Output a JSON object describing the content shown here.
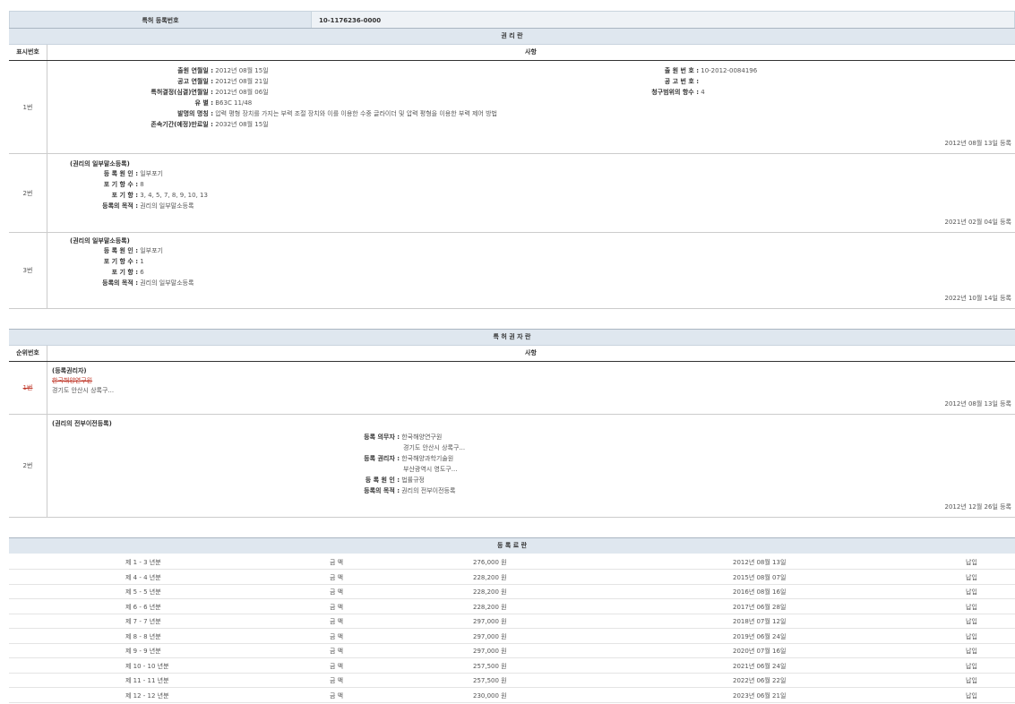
{
  "registration": {
    "label": "특허 등록번호",
    "value": "10-1176236-0000"
  },
  "rights": {
    "title": "권 리 란",
    "col_num": "표시번호",
    "col_detail": "사항",
    "entry1": {
      "num": "1번",
      "left": [
        {
          "k": "출원 연월일 :",
          "v": "2012년 08월 15일"
        },
        {
          "k": "공고 연월일 :",
          "v": "2012년 08월 21일"
        },
        {
          "k": "특허결정(심결)연월일 :",
          "v": "2012년 08월 06일"
        },
        {
          "k": "유 별 :",
          "v": "B63C 11/48"
        },
        {
          "k": "발명의 명칭 :",
          "v": "압력 평형 장치를 가지는 부력 조절 장치와 이를 이용한 수중 글라이더 및 압력 평형을 이용한 부력 제어 방법"
        },
        {
          "k": "존속기간(예정)만료일 :",
          "v": "2032년 08월 15일"
        }
      ],
      "right": [
        {
          "k": "출 원 번 호 :",
          "v": "10-2012-0084196"
        },
        {
          "k": "공 고 번 호 :",
          "v": ""
        },
        {
          "k": "청구범위의 항수 :",
          "v": "4"
        }
      ],
      "date": "2012년 08월 13일 등록"
    },
    "entry2": {
      "num": "2번",
      "head": "(권리의 일부말소등록)",
      "items": [
        {
          "k": "등 록 원 인 :",
          "v": "일부포기"
        },
        {
          "k": "포 기 항 수 :",
          "v": "8"
        },
        {
          "k": "포 기 항 :",
          "v": "3, 4, 5, 7, 8, 9, 10, 13"
        },
        {
          "k": "등록의 목적 :",
          "v": "권리의 일부말소등록"
        }
      ],
      "date": "2021년 02월 04일 등록"
    },
    "entry3": {
      "num": "3번",
      "head": "(권리의 일부말소등록)",
      "items": [
        {
          "k": "등 록 원 인 :",
          "v": "일부포기"
        },
        {
          "k": "포 기 항 수 :",
          "v": "1"
        },
        {
          "k": "포 기 항 :",
          "v": "6"
        },
        {
          "k": "등록의 목적 :",
          "v": "권리의 일부말소등록"
        }
      ],
      "date": "2022년 10월 14일 등록"
    }
  },
  "holders": {
    "title": "특 허 권 자 란",
    "col_num": "순위번호",
    "col_detail": "사항",
    "entry1": {
      "num": "1번",
      "head": "(등록권리자)",
      "name": "한국해양연구원",
      "addr": "경기도 안산시 상록구...",
      "date": "2012년 08월 13일 등록"
    },
    "entry2": {
      "num": "2번",
      "head": "(권리의 전부이전등록)",
      "obligor_k": "등록 의무자 :",
      "obligor_v": "한국해양연구원",
      "obligor_addr": "경기도 안산시 상록구...",
      "holder_k": "등록 권리자 :",
      "holder_v": "한국해양과학기술원",
      "holder_addr": "부산광역시 영도구...",
      "cause_k": "등 록 원 인 :",
      "cause_v": "법률규정",
      "purpose_k": "등록의 목적 :",
      "purpose_v": "권리의 전부이전등록",
      "date": "2012년 12월 26일 등록"
    }
  },
  "fees": {
    "title": "등 록 료 란",
    "rows": [
      {
        "period": "제 1 - 3 년분",
        "label": "금 액",
        "amount": "276,000 원",
        "date": "2012년 08월 13일",
        "status": "납입"
      },
      {
        "period": "제 4 - 4 년분",
        "label": "금 액",
        "amount": "228,200 원",
        "date": "2015년 08월 07일",
        "status": "납입"
      },
      {
        "period": "제 5 - 5 년분",
        "label": "금 액",
        "amount": "228,200 원",
        "date": "2016년 08월 16일",
        "status": "납입"
      },
      {
        "period": "제 6 - 6 년분",
        "label": "금 액",
        "amount": "228,200 원",
        "date": "2017년 06월 28일",
        "status": "납입"
      },
      {
        "period": "제 7 - 7 년분",
        "label": "금 액",
        "amount": "297,000 원",
        "date": "2018년 07월 12일",
        "status": "납입"
      },
      {
        "period": "제 8 - 8 년분",
        "label": "금 액",
        "amount": "297,000 원",
        "date": "2019년 06월 24일",
        "status": "납입"
      },
      {
        "period": "제 9 - 9 년분",
        "label": "금 액",
        "amount": "297,000 원",
        "date": "2020년 07월 16일",
        "status": "납입"
      },
      {
        "period": "제 10 - 10 년분",
        "label": "금 액",
        "amount": "257,500 원",
        "date": "2021년 06월 24일",
        "status": "납입"
      },
      {
        "period": "제 11 - 11 년분",
        "label": "금 액",
        "amount": "257,500 원",
        "date": "2022년 06월 22일",
        "status": "납입"
      },
      {
        "period": "제 12 - 12 년분",
        "label": "금 액",
        "amount": "230,000 원",
        "date": "2023년 06월 21일",
        "status": "납입"
      }
    ]
  }
}
